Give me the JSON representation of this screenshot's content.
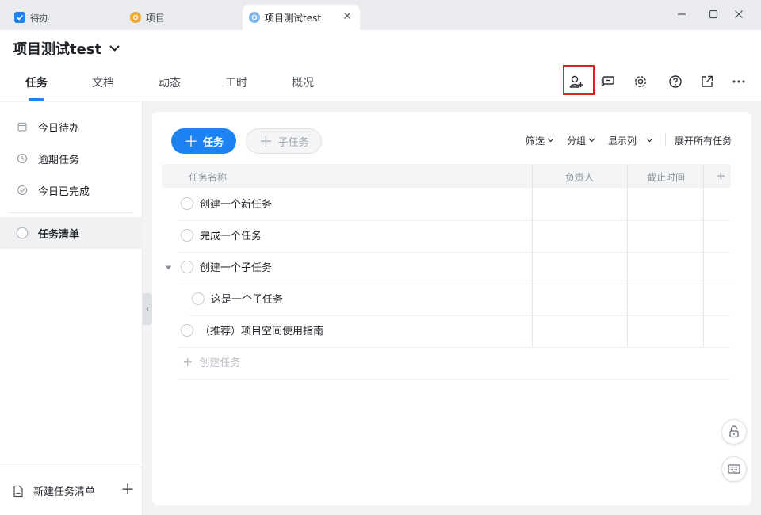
{
  "tabs": [
    {
      "label": "待办",
      "icon": "checkbox-icon"
    },
    {
      "label": "项目",
      "icon": "project-icon"
    },
    {
      "label": "项目测试test",
      "icon": "project-icon"
    }
  ],
  "window_controls": [
    "minimize-icon",
    "maximize-icon",
    "close-icon"
  ],
  "header": {
    "project_title": "项目测试test",
    "nav_tabs": [
      "任务",
      "文档",
      "动态",
      "工时",
      "概况"
    ],
    "active_nav": "任务",
    "action_icons": [
      "add-member-icon",
      "chat-icon",
      "settings-icon",
      "help-icon",
      "open-external-icon",
      "more-icon"
    ]
  },
  "sidebar": {
    "items": [
      {
        "label": "今日待办",
        "icon": "calendar-icon"
      },
      {
        "label": "逾期任务",
        "icon": "clock-icon"
      },
      {
        "label": "今日已完成",
        "icon": "check-circle-icon"
      },
      {
        "label": "任务清单",
        "icon": "circle-icon",
        "active": true
      }
    ],
    "footer_label": "新建任务清单"
  },
  "toolbar": {
    "add_task": "任务",
    "add_subtask": "子任务",
    "filter": "筛选",
    "group": "分组",
    "display_columns": "显示列",
    "expand_all": "展开所有任务"
  },
  "table": {
    "columns": [
      "任务名称",
      "负责人",
      "截止时间"
    ],
    "rows": [
      {
        "name": "创建一个新任务",
        "level": 0
      },
      {
        "name": "完成一个任务",
        "level": 0
      },
      {
        "name": "创建一个子任务",
        "level": 0,
        "expanded": true
      },
      {
        "name": "这是一个子任务",
        "level": 1
      },
      {
        "name": "（推荐）项目空间使用指南",
        "level": 0
      }
    ],
    "create_placeholder": "创建任务"
  },
  "colors": {
    "accent": "#1d83f2",
    "highlight_box": "#e02020"
  }
}
